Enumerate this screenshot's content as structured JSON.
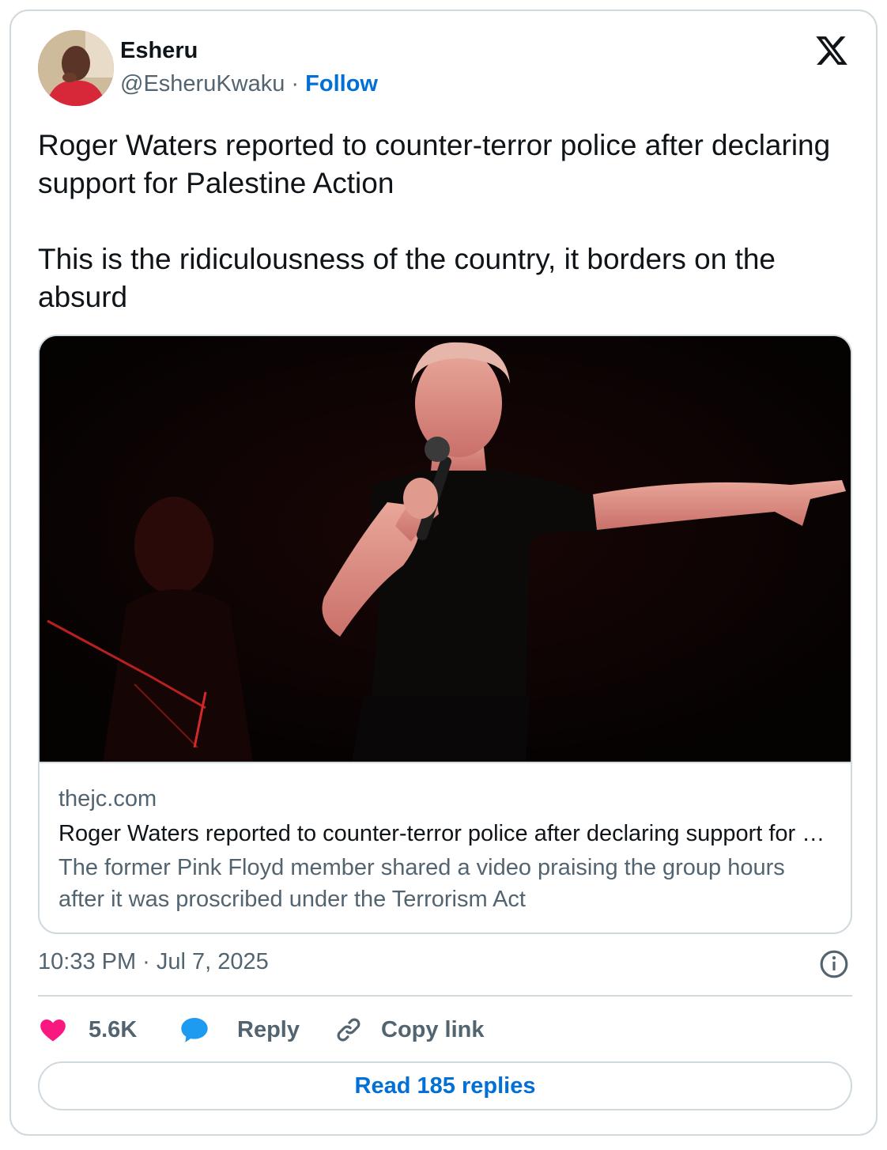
{
  "author": {
    "name": "Esheru",
    "handle": "@EsheruKwaku",
    "separator": " · ",
    "follow_label": "Follow"
  },
  "brand": {
    "logo_icon": "x-logo-icon"
  },
  "tweet": {
    "paragraphs": [
      "Roger Waters reported to counter-terror police after declaring support for Palestine Action",
      "This is the ridiculousness of the country, it borders on the absurd"
    ]
  },
  "link_card": {
    "image_icon": "concert-photo",
    "domain": "thejc.com",
    "title": "Roger Waters reported to counter-terror police after declaring support for Palestine Action",
    "description": "The former Pink Floyd member shared a video praising the group hours after it was proscribed under the Terrorism Act"
  },
  "meta": {
    "timestamp": "10:33 PM · Jul 7, 2025",
    "info_icon": "info-icon"
  },
  "actions": {
    "like_count": "5.6K",
    "reply_label": "Reply",
    "copy_link_label": "Copy link"
  },
  "read_replies_label": "Read 185 replies",
  "colors": {
    "accent": "#006fd6",
    "like": "#f91880",
    "reply": "#1d9bf0",
    "muted": "#536471",
    "border": "#cfd9de"
  }
}
